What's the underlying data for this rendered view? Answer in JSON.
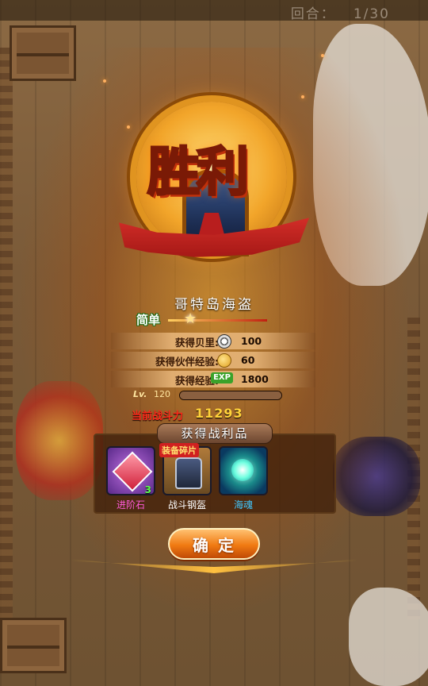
{
  "hud": {
    "round_label": "回合：",
    "round_value": "1/30"
  },
  "emblem": {
    "title": "胜利"
  },
  "result": {
    "enemy_name": "哥特岛海盗",
    "difficulty_label": "简单",
    "rewards": [
      {
        "label": "获得贝里:",
        "icon": "berry-coin-icon",
        "value": "100"
      },
      {
        "label": "获得伙伴经验:",
        "icon": "companion-exp-icon",
        "value": "60"
      },
      {
        "label": "获得经验:",
        "icon": "exp-badge-icon",
        "icon_text": "EXP",
        "value": "1800"
      }
    ],
    "level_label": "Lv.",
    "level_value": "120",
    "level_progress": 1.0,
    "power_label": "当前战斗力",
    "power_value": "11293"
  },
  "loot": {
    "title": "获得战利品",
    "items": [
      {
        "name": "进阶石",
        "icon": "red-gem-icon",
        "quantity": "3",
        "name_color": "#ff5ad8"
      },
      {
        "name": "战斗钢盔",
        "icon": "armor-icon",
        "tag": "装备碎片",
        "name_color": "#ffffff"
      },
      {
        "name": "海魂",
        "icon": "sea-soul-orb-icon",
        "name_color": "#40c8ff"
      }
    ]
  },
  "actions": {
    "confirm_label": "确定"
  }
}
